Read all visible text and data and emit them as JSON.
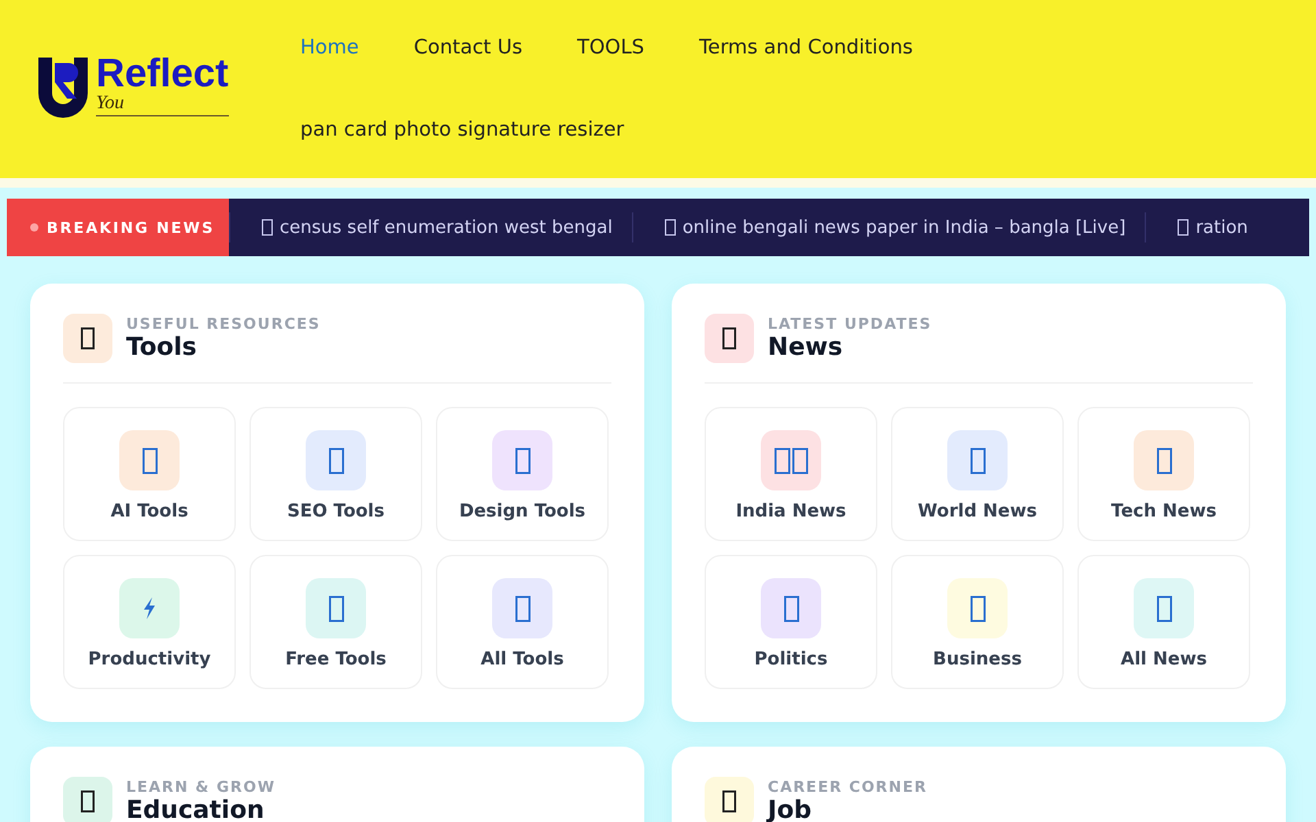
{
  "header": {
    "logo": {
      "word": "Reflect",
      "tagline": "You"
    },
    "nav": [
      {
        "label": "Home",
        "selected": true
      },
      {
        "label": "Contact Us",
        "selected": false
      },
      {
        "label": "TOOLS",
        "selected": false
      },
      {
        "label": "Terms and Conditions",
        "selected": false
      },
      {
        "label": "pan card photo signature resizer",
        "selected": false
      }
    ]
  },
  "breaking_news": {
    "label": "BREAKING NEWS",
    "items": [
      "census self enumeration west bengal",
      "online bengali news paper in India – bangla [Live]",
      "ration"
    ]
  },
  "sections": [
    {
      "eyebrow": "USEFUL RESOURCES",
      "title": "Tools",
      "color": "#fdebdc",
      "tiles": [
        {
          "label": "AI Tools",
          "kind": "box",
          "color": "#fdeadb"
        },
        {
          "label": "SEO Tools",
          "kind": "box",
          "color": "#e3ebfd"
        },
        {
          "label": "Design Tools",
          "kind": "box",
          "color": "#efe3fd"
        },
        {
          "label": "Productivity",
          "kind": "bolt",
          "color": "#dcf7ea"
        },
        {
          "label": "Free Tools",
          "kind": "box",
          "color": "#dcf6f3"
        },
        {
          "label": "All Tools",
          "kind": "box",
          "color": "#e7e8fd"
        }
      ]
    },
    {
      "eyebrow": "LATEST UPDATES",
      "title": "News",
      "color": "#fde1e3",
      "tiles": [
        {
          "label": "India News",
          "kind": "double-box",
          "color": "#fde1e3"
        },
        {
          "label": "World News",
          "kind": "box",
          "color": "#e3ebfd"
        },
        {
          "label": "Tech News",
          "kind": "box",
          "color": "#fdeadb"
        },
        {
          "label": "Politics",
          "kind": "box",
          "color": "#ebe3fd"
        },
        {
          "label": "Business",
          "kind": "box",
          "color": "#fefbe0"
        },
        {
          "label": "All News",
          "kind": "box",
          "color": "#def7f5"
        }
      ]
    },
    {
      "eyebrow": "LEARN & GROW",
      "title": "Education",
      "color": "#dcf5ea"
    },
    {
      "eyebrow": "CAREER CORNER",
      "title": "Job",
      "color": "#fef9dc"
    }
  ]
}
